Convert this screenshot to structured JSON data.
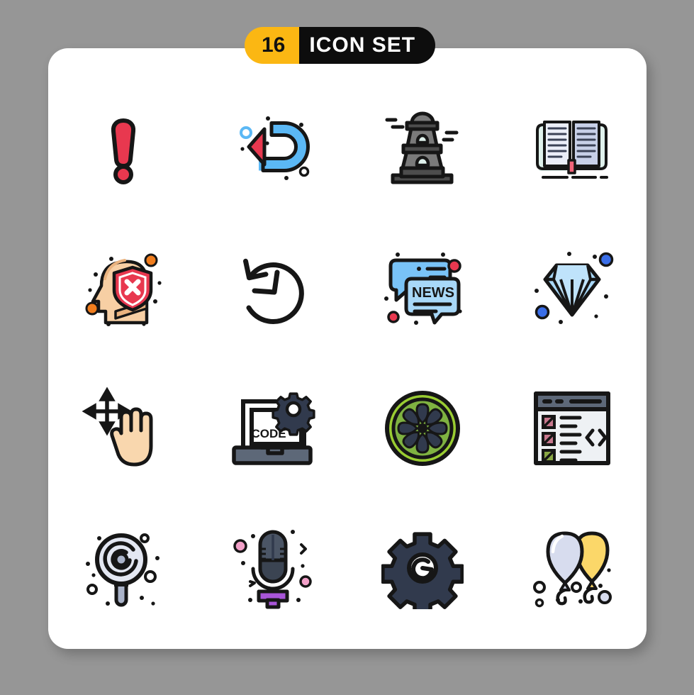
{
  "page": {
    "background_color": "#969696",
    "card_color": "#ffffff"
  },
  "header": {
    "count_label": "16",
    "title_label": "ICON SET",
    "count_bg": "#fbb713",
    "title_bg": "#0d0d0d",
    "title_color": "#ffffff"
  },
  "palette": {
    "stroke": "#161616",
    "red": "#e8384f",
    "red_dark": "#d82c46",
    "blue": "#5bb8f5",
    "blue_light": "#a8d8f8",
    "blue_accent": "#3a6ee8",
    "gray": "#7a7a7a",
    "gray_dark": "#4d4d4d",
    "mint": "#dff1ec",
    "page_blue": "#c8d0e8",
    "skin": "#f7cfa4",
    "skin_light": "#fae0c2",
    "orange": "#f07d1e",
    "green": "#9acd32",
    "green_dark": "#74a83c",
    "slate": "#313a4d",
    "lavender": "#ccd0e0",
    "purple": "#a855d8",
    "pink": "#f2a0c8",
    "yellow": "#fbd769"
  },
  "icons": [
    {
      "index": 1,
      "name": "exclamation-mark-icon",
      "label": "Exclamation Mark",
      "row": 1,
      "col": 1
    },
    {
      "index": 2,
      "name": "u-turn-arrow-icon",
      "label": "U Turn Arrow",
      "row": 1,
      "col": 2
    },
    {
      "index": 3,
      "name": "lighthouse-icon",
      "label": "Lighthouse Tower",
      "row": 1,
      "col": 3
    },
    {
      "index": 4,
      "name": "open-book-icon",
      "label": "Open Book",
      "row": 1,
      "col": 4
    },
    {
      "index": 5,
      "name": "head-shield-block-icon",
      "label": "Head Shield Block",
      "row": 2,
      "col": 1
    },
    {
      "index": 6,
      "name": "clock-history-icon",
      "label": "Clock History",
      "row": 2,
      "col": 2
    },
    {
      "index": 7,
      "name": "news-chat-icon",
      "label": "News Chat Bubbles",
      "row": 2,
      "col": 3,
      "text": "NEWS"
    },
    {
      "index": 8,
      "name": "diamond-icon",
      "label": "Diamond",
      "row": 2,
      "col": 4
    },
    {
      "index": 9,
      "name": "drag-hand-gesture-icon",
      "label": "Drag Hand Gesture",
      "row": 3,
      "col": 1
    },
    {
      "index": 10,
      "name": "laptop-code-gear-icon",
      "label": "Laptop Code Settings",
      "row": 3,
      "col": 2,
      "text": "CODE"
    },
    {
      "index": 11,
      "name": "lime-slice-icon",
      "label": "Lime Slice",
      "row": 3,
      "col": 3
    },
    {
      "index": 12,
      "name": "code-browser-icon",
      "label": "Code Browser Window",
      "row": 3,
      "col": 4
    },
    {
      "index": 13,
      "name": "lollipop-magnifier-icon",
      "label": "Spiral Magnifier",
      "row": 4,
      "col": 1
    },
    {
      "index": 14,
      "name": "microphone-icon",
      "label": "Microphone",
      "row": 4,
      "col": 2
    },
    {
      "index": 15,
      "name": "gear-settings-icon",
      "label": "Gear Settings",
      "row": 4,
      "col": 3
    },
    {
      "index": 16,
      "name": "balloons-icon",
      "label": "Balloons",
      "row": 4,
      "col": 4
    }
  ]
}
